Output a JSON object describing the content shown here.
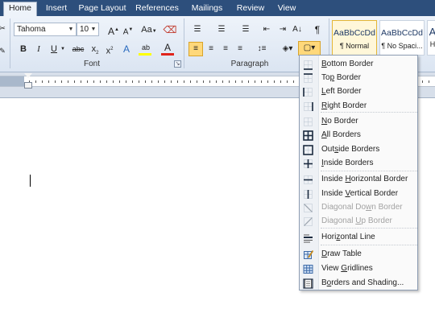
{
  "tabs": [
    {
      "label": "Home",
      "active": true
    },
    {
      "label": "Insert"
    },
    {
      "label": "Page Layout"
    },
    {
      "label": "References"
    },
    {
      "label": "Mailings"
    },
    {
      "label": "Review"
    },
    {
      "label": "View"
    }
  ],
  "font_group": {
    "font_name": "Tahoma",
    "font_size": "10",
    "grow": "A",
    "shrink": "A",
    "change_case": "Aa",
    "bold": "B",
    "italic": "I",
    "underline": "U",
    "strikethrough": "abc",
    "subscript": "x",
    "superscript": "x",
    "highlight": "ab",
    "font_color": "A",
    "label": "Font"
  },
  "paragraph_group": {
    "show_marks": "¶",
    "sort": "A↓",
    "label": "Paragraph"
  },
  "styles": [
    {
      "sample": "AaBbCcDd",
      "name": "¶ Normal",
      "active": true
    },
    {
      "sample": "AaBbCcDd",
      "name": "¶ No Spaci..."
    },
    {
      "sample": "A",
      "name": "H"
    }
  ],
  "colors": {
    "highlight_bar": "#ffff00",
    "font_color_bar": "#e0241b",
    "selected": "#ffd87a"
  },
  "border_menu": {
    "items": [
      {
        "label": "Bottom Border",
        "key": "B",
        "icon": "bottom-border-icon"
      },
      {
        "label": "Top Border",
        "key": "P",
        "icon": "top-border-icon"
      },
      {
        "label": "Left Border",
        "key": "L",
        "icon": "left-border-icon"
      },
      {
        "label": "Right Border",
        "key": "R",
        "icon": "right-border-icon"
      },
      {
        "label": "No Border",
        "key": "N",
        "icon": "no-border-icon"
      },
      {
        "label": "All Borders",
        "key": "A",
        "icon": "all-borders-icon"
      },
      {
        "label": "Outside Borders",
        "key": "S",
        "icon": "outside-borders-icon"
      },
      {
        "label": "Inside Borders",
        "key": "I",
        "icon": "inside-borders-icon"
      },
      {
        "label": "Inside Horizontal Border",
        "key": "H",
        "icon": "inside-horizontal-border-icon"
      },
      {
        "label": "Inside Vertical Border",
        "key": "V",
        "icon": "inside-vertical-border-icon"
      },
      {
        "label": "Diagonal Down Border",
        "key": "W",
        "icon": "diagonal-down-border-icon",
        "disabled": true
      },
      {
        "label": "Diagonal Up Border",
        "key": "U",
        "icon": "diagonal-up-border-icon",
        "disabled": true
      },
      {
        "label": "Horizontal Line",
        "key": "Z",
        "icon": "horizontal-line-icon"
      },
      {
        "label": "Draw Table",
        "key": "D",
        "icon": "draw-table-icon"
      },
      {
        "label": "View Gridlines",
        "key": "G",
        "icon": "view-gridlines-icon"
      },
      {
        "label": "Borders and Shading...",
        "key": "O",
        "icon": "borders-and-shading-icon"
      }
    ]
  }
}
